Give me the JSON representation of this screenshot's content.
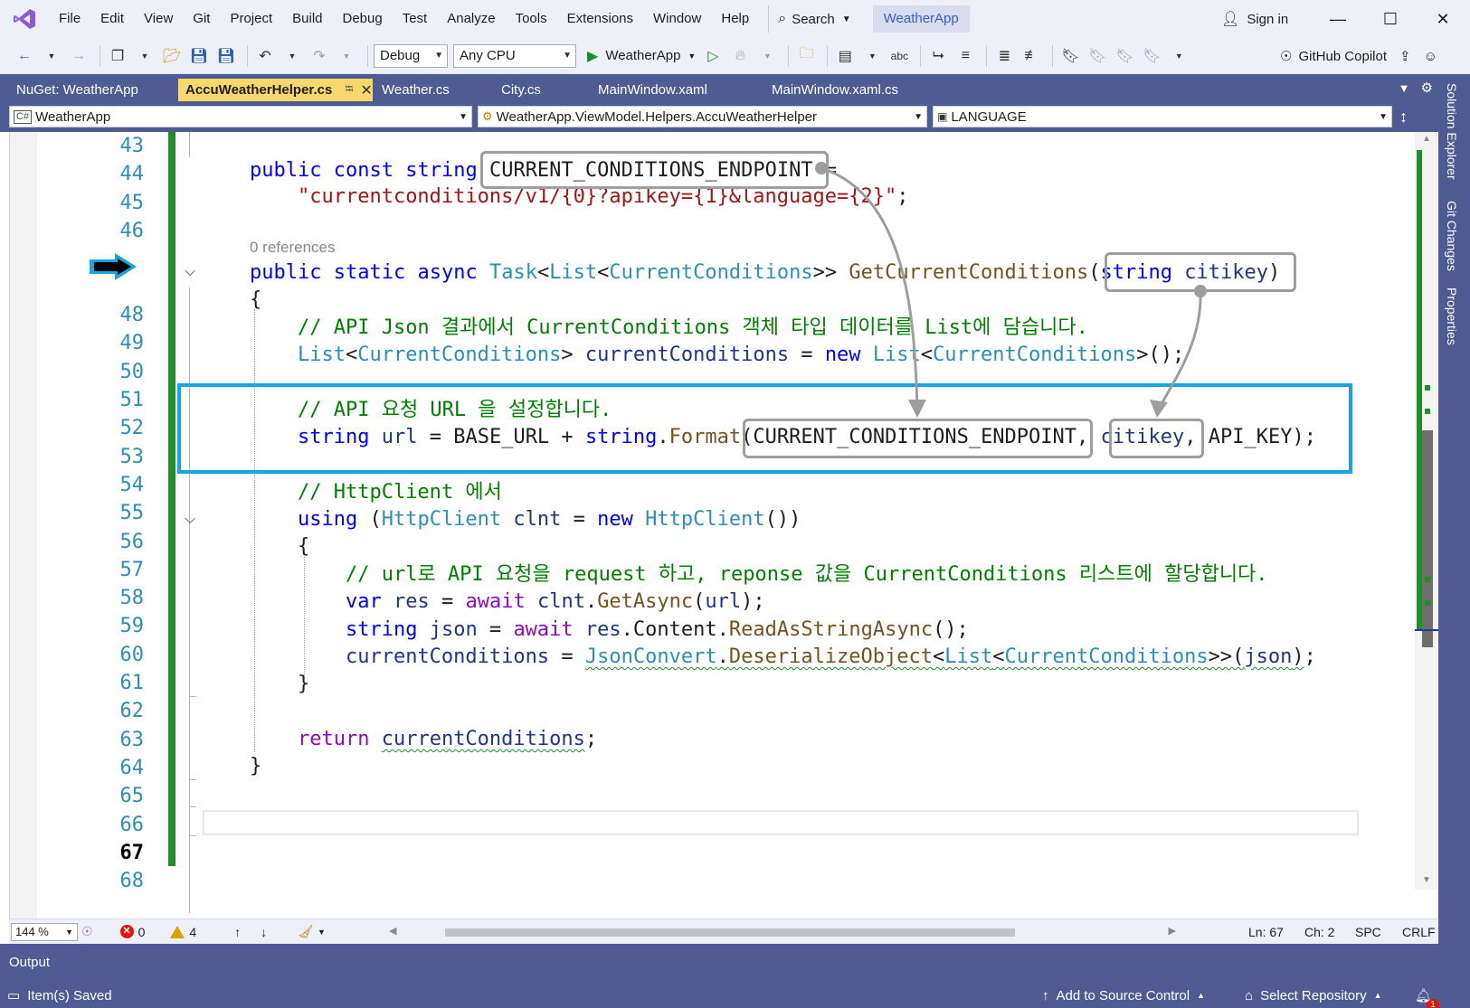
{
  "menu": {
    "items": [
      "File",
      "Edit",
      "View",
      "Git",
      "Project",
      "Build",
      "Debug",
      "Test",
      "Analyze",
      "Tools",
      "Extensions",
      "Window",
      "Help"
    ],
    "search_label": "Search",
    "solution_name": "WeatherApp",
    "sign_in": "Sign in"
  },
  "toolbar": {
    "configuration": "Debug",
    "platform": "Any CPU",
    "run_target": "WeatherApp",
    "copilot": "GitHub Copilot"
  },
  "tabs": [
    {
      "label": "NuGet: WeatherApp",
      "active": false
    },
    {
      "label": "AccuWeatherHelper.cs",
      "active": true
    },
    {
      "label": "Weather.cs",
      "active": false
    },
    {
      "label": "City.cs",
      "active": false
    },
    {
      "label": "MainWindow.xaml",
      "active": false
    },
    {
      "label": "MainWindow.xaml.cs",
      "active": false
    }
  ],
  "navbar": {
    "project": "WeatherApp",
    "type": "WeatherApp.ViewModel.Helpers.AccuWeatherHelper",
    "member": "LANGUAGE"
  },
  "side_panels": [
    "Solution Explorer",
    "Git Changes",
    "Properties"
  ],
  "editor": {
    "line_numbers": [
      "43",
      "44",
      "45",
      "46",
      "",
      "48",
      "49",
      "50",
      "51",
      "52",
      "53",
      "54",
      "55",
      "56",
      "57",
      "58",
      "59",
      "60",
      "61",
      "62",
      "63",
      "64",
      "65",
      "66",
      "67",
      "68"
    ],
    "current_line": "67",
    "code_lens": "0 references"
  },
  "status": {
    "zoom": "144 %",
    "errors": "0",
    "warnings": "4",
    "line": "Ln: 67",
    "col": "Ch: 2",
    "whitespace": "SPC",
    "line_ending": "CRLF"
  },
  "output_panel": "Output",
  "statusbar": {
    "message": "Item(s) Saved",
    "source_control": "Add to Source Control",
    "repository": "Select Repository",
    "notifications": "1"
  },
  "colors": {
    "accent": "#4e5c93",
    "active_tab": "#f8d86c",
    "change_bar": "#1e8f2b",
    "highlight_box": "#16a4e4",
    "callout_box": "#9e9e9e"
  }
}
